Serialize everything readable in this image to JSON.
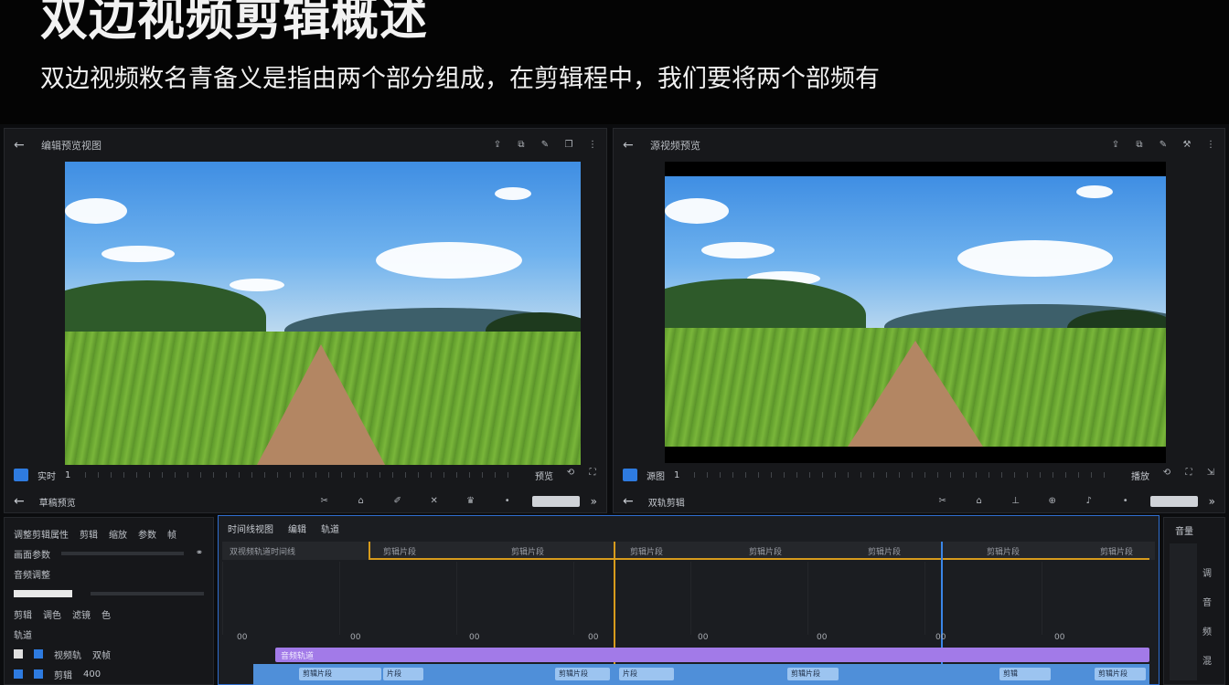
{
  "banner": {
    "title": "双边视频剪辑概述",
    "subtitle": "双边视频敉名青备义是指由两个部分组成，在剪辑程中，我们要将两个部频有"
  },
  "left_panel": {
    "name": "编辑预览视图",
    "footer_label": "实时",
    "footer_value": "1",
    "footer_right": "预览",
    "foot2_label": "草稿预览"
  },
  "right_panel": {
    "name": "源视频预览",
    "footer_label": "源图",
    "footer_value": "1",
    "footer_right": "播放",
    "foot2_label": "双轨剪辑"
  },
  "props": {
    "header": "调整剪辑属性",
    "tabs": [
      "剪辑",
      "缩放",
      "参数",
      "帧"
    ],
    "row1_label": "画面参数",
    "row2_label": "音频调整",
    "row3_labels": [
      "剪辑",
      "调色",
      "滤镜",
      "色"
    ],
    "section_label": "轨道",
    "rows": [
      {
        "label": "视频轨",
        "value": "双帧"
      },
      {
        "label": "剪辑",
        "value": "400"
      }
    ]
  },
  "timeline": {
    "title": "时间线视图",
    "tabs": [
      "编辑",
      "轨道"
    ],
    "ruler_left": "双视频轨道时间线",
    "segments": [
      "剪辑片段",
      "剪辑片段",
      "剪辑片段",
      "剪辑片段",
      "剪辑片段",
      "剪辑片段",
      "剪辑片段"
    ],
    "times": [
      "00",
      "00",
      "00",
      "00",
      "00",
      "00",
      "00",
      "00"
    ],
    "purple_label": "音频轨道",
    "clips": [
      "剪辑片段",
      "片段",
      "剪辑片段",
      "片段",
      "剪辑片段",
      "剪辑",
      "剪辑片段"
    ]
  },
  "side_panel": {
    "label": "音量",
    "marks": [
      "调",
      "音",
      "频",
      "混"
    ]
  },
  "colors": {
    "accent_blue": "#2e7be0",
    "timeline_border": "#2f6ed0",
    "playhead_amber": "#d79b1c",
    "playhead_blue": "#3a86e8",
    "audio_track": "#a27ae8",
    "video_track": "#4f8fd9"
  },
  "icons": [
    "back-arrow-icon",
    "export-icon",
    "settings-icon",
    "play-icon",
    "fullscreen-icon",
    "cut-icon",
    "undo-icon",
    "redo-icon"
  ]
}
